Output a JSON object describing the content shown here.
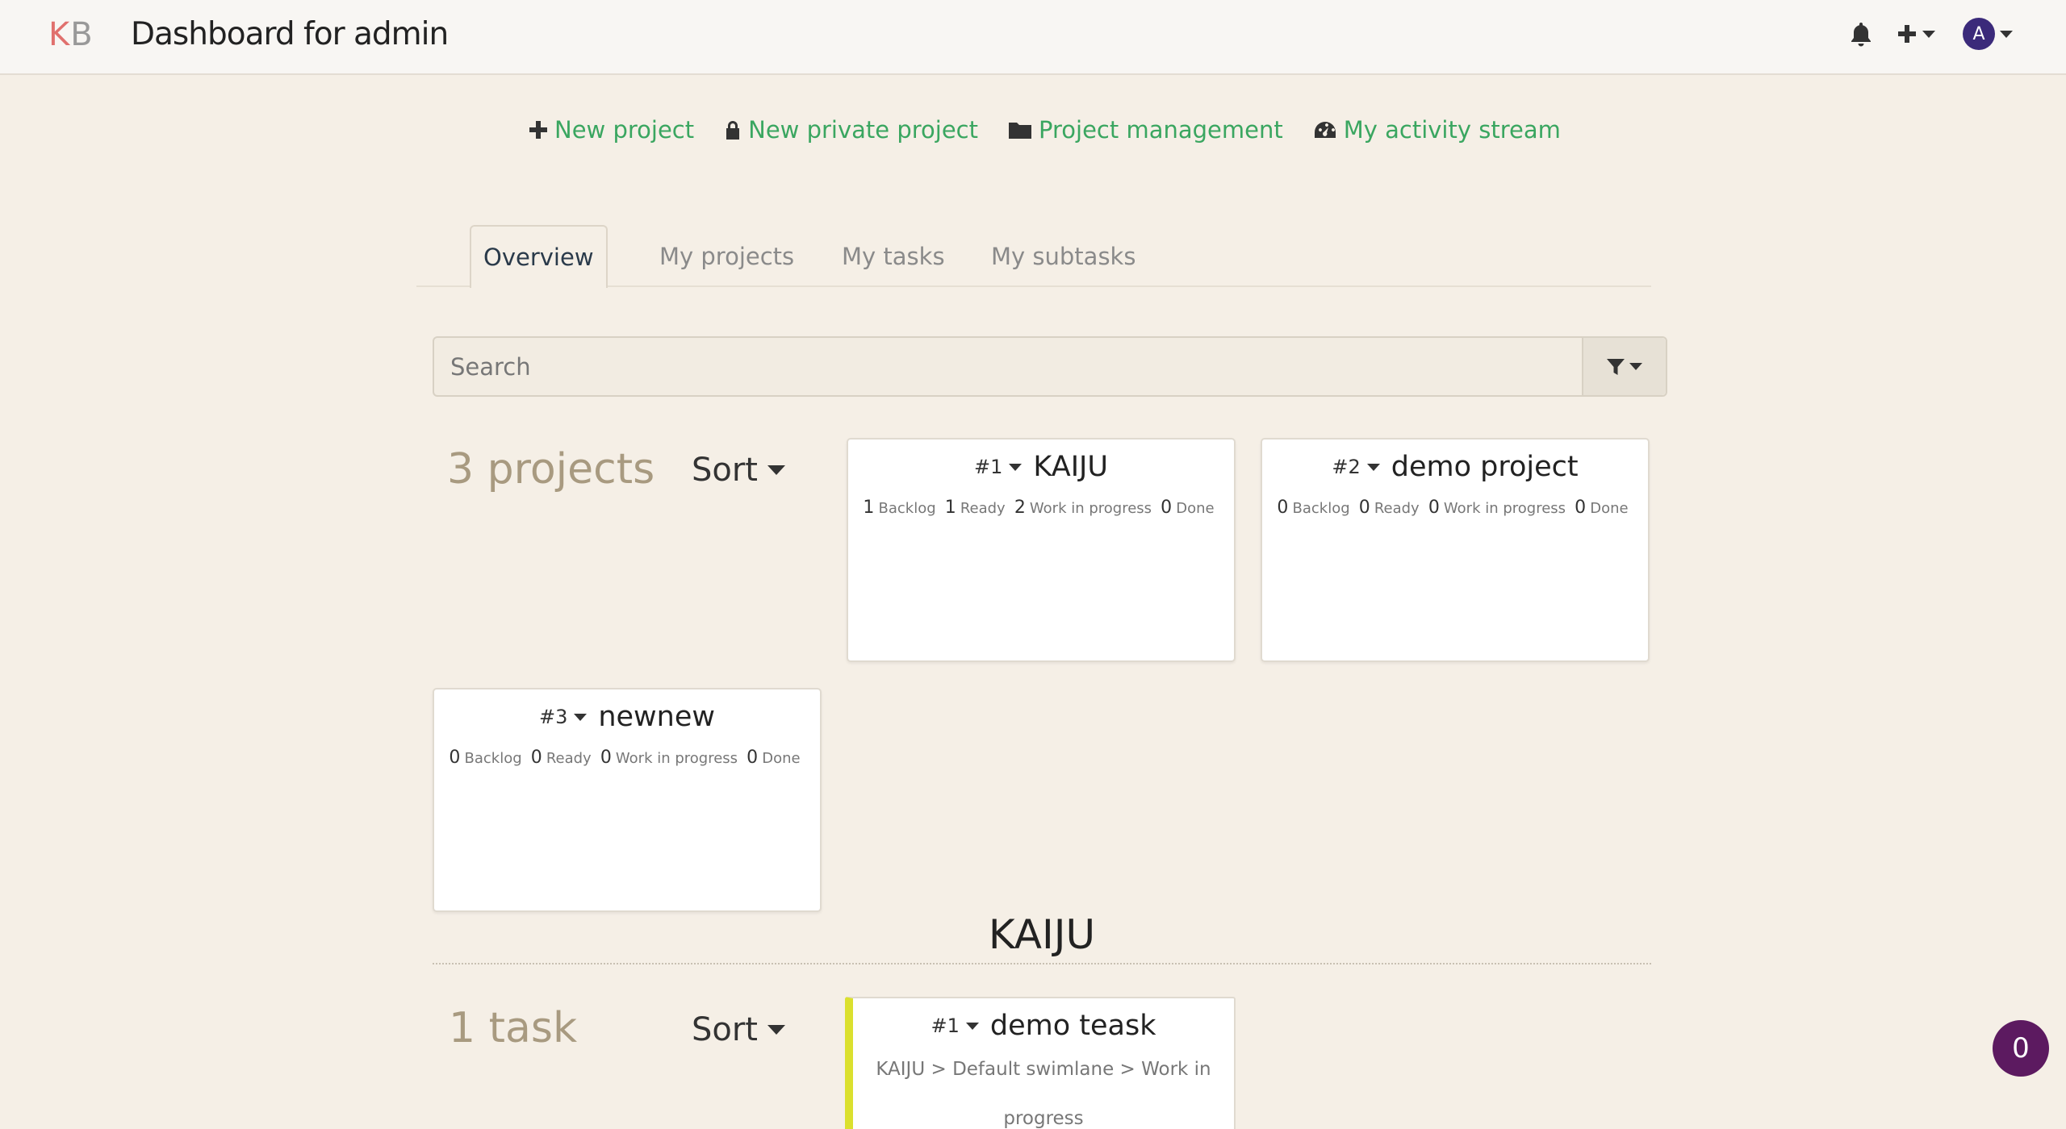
{
  "header": {
    "logo_k": "K",
    "logo_b": "B",
    "title": "Dashboard for admin",
    "avatar_letter": "A",
    "icons": [
      "bell-icon",
      "plus-icon",
      "user-avatar"
    ]
  },
  "actions": [
    {
      "label": "New project",
      "icon": "plus-icon"
    },
    {
      "label": "New private project",
      "icon": "lock-icon"
    },
    {
      "label": "Project management",
      "icon": "folder-icon"
    },
    {
      "label": "My activity stream",
      "icon": "dashboard-icon"
    }
  ],
  "tabs": [
    {
      "label": "Overview",
      "active": true
    },
    {
      "label": "My projects",
      "active": false
    },
    {
      "label": "My tasks",
      "active": false
    },
    {
      "label": "My subtasks",
      "active": false
    }
  ],
  "search": {
    "placeholder": "Search",
    "value": ""
  },
  "projects": {
    "count_label": "3 projects",
    "sort_label": "Sort",
    "items": [
      {
        "id": "#1",
        "name": "KAIJU",
        "stats": [
          {
            "n": "1",
            "l": "Backlog"
          },
          {
            "n": "1",
            "l": "Ready"
          },
          {
            "n": "2",
            "l": "Work in progress"
          },
          {
            "n": "0",
            "l": "Done"
          }
        ]
      },
      {
        "id": "#2",
        "name": "demo project",
        "stats": [
          {
            "n": "0",
            "l": "Backlog"
          },
          {
            "n": "0",
            "l": "Ready"
          },
          {
            "n": "0",
            "l": "Work in progress"
          },
          {
            "n": "0",
            "l": "Done"
          }
        ]
      },
      {
        "id": "#3",
        "name": "newnew",
        "stats": [
          {
            "n": "0",
            "l": "Backlog"
          },
          {
            "n": "0",
            "l": "Ready"
          },
          {
            "n": "0",
            "l": "Work in progress"
          },
          {
            "n": "0",
            "l": "Done"
          }
        ]
      }
    ]
  },
  "section": {
    "title": "KAIJU",
    "count_label": "1 task",
    "sort_label": "Sort",
    "task": {
      "id": "#1",
      "name": "demo teask",
      "path": "KAIJU > Default swimlane > Work in progress",
      "color": "#dbe02e"
    }
  },
  "notification_badge": "0",
  "colors": {
    "accent_green": "#3aa660",
    "background": "#f5efe6",
    "badge": "#5c1a60",
    "avatar": "#3b2a7a"
  }
}
